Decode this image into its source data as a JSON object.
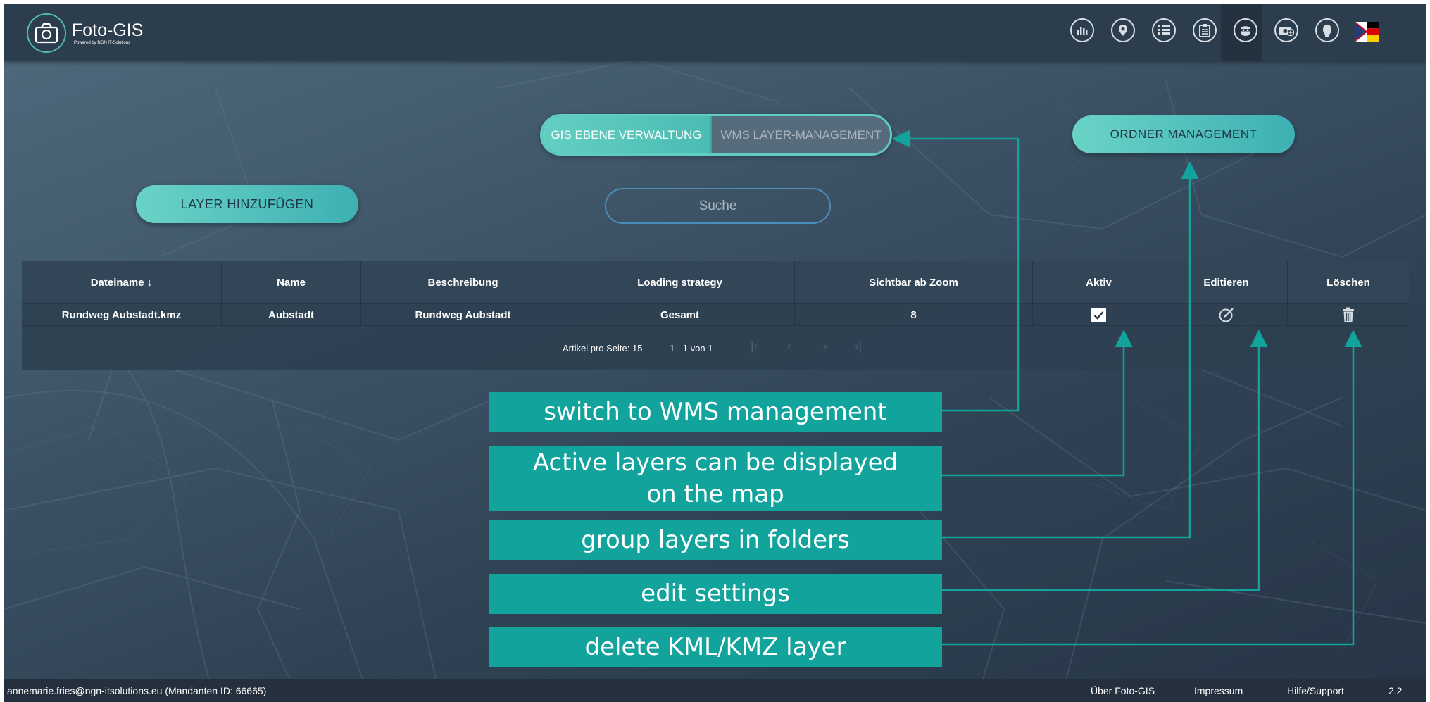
{
  "app": {
    "title": "Foto-GIS",
    "subtitle": "Powered by NGN IT-Solutions"
  },
  "header": {
    "icons": [
      "statistics-icon",
      "map-pin-icon",
      "layers-list-icon",
      "clipboard-icon",
      "admin-mask-icon",
      "camera-add-icon",
      "user-icon",
      "language-flag-icon"
    ],
    "active_icon": "admin-mask-icon"
  },
  "toggle": {
    "left_label": "GIS EBENE VERWALTUNG",
    "right_label": "WMS LAYER-MANAGEMENT",
    "active": "left"
  },
  "buttons": {
    "ordner": "ORDNER MANAGEMENT",
    "layer_add": "LAYER HINZUFÜGEN"
  },
  "search": {
    "placeholder": "Suche"
  },
  "table": {
    "columns": [
      "Dateiname ↓",
      "Name",
      "Beschreibung",
      "Loading strategy",
      "Sichtbar ab Zoom",
      "Aktiv",
      "Editieren",
      "Löschen"
    ],
    "rows": [
      {
        "dateiname": "Rundweg Aubstadt.kmz",
        "name": "Aubstadt",
        "beschreibung": "Rundweg Aubstadt",
        "loading": "Gesamt",
        "zoom": "8",
        "aktiv": true
      }
    ],
    "pager": {
      "per_page_label": "Artikel pro Seite: 15",
      "range": "1 - 1 von 1"
    }
  },
  "callouts": {
    "wms": "switch to WMS management",
    "active_line1": "Active layers can be displayed",
    "active_line2": "on the map",
    "folders": "group layers in folders",
    "edit": "edit settings",
    "delete": "delete KML/KMZ layer"
  },
  "footer": {
    "user": "annemarie.fries@ngn-itsolutions.eu (Mandanten ID: 66665)",
    "about": "Über Foto-GIS",
    "impressum": "Impressum",
    "help": "Hilfe/Support",
    "version": "2.2"
  },
  "colors": {
    "accent": "#12a39c",
    "header": "#2c3d4e",
    "toggle_active": "#5fcdc1"
  }
}
